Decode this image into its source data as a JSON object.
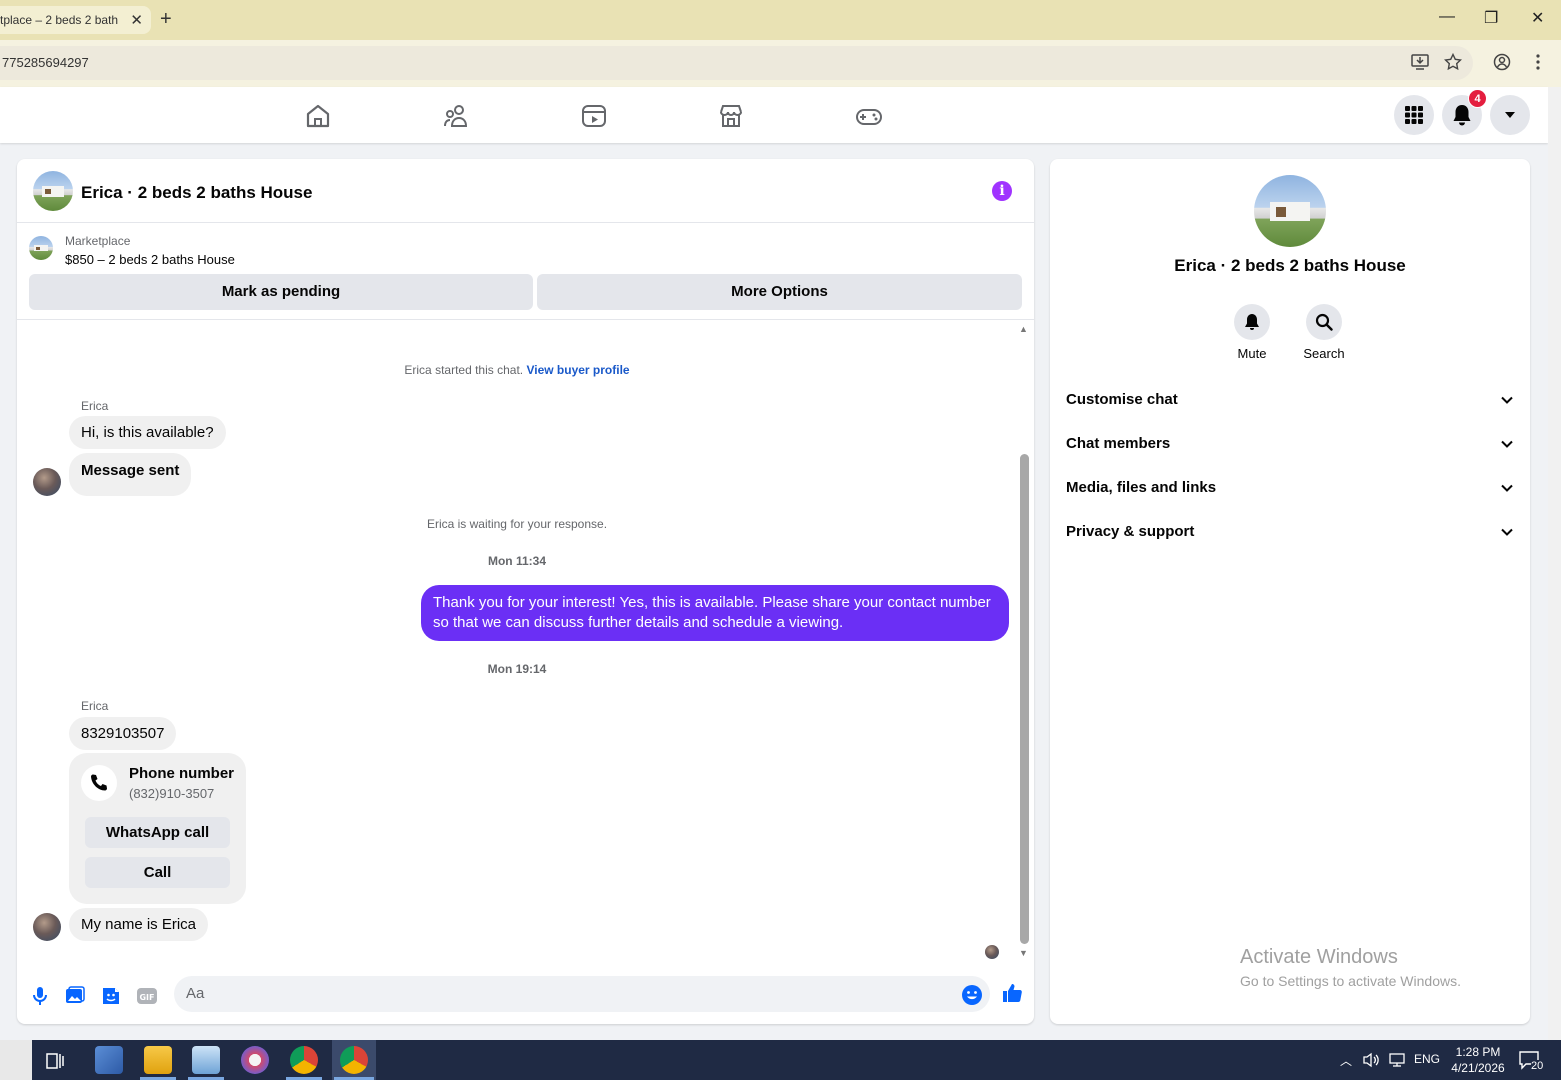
{
  "browser": {
    "tab_title": "tplace – 2 beds 2 bath",
    "tab_close": "✕",
    "new_tab": "+",
    "url": "775285694297",
    "window": {
      "minimize": "—",
      "restore": "❐",
      "close": "✕"
    }
  },
  "fb_nav": {
    "notification_count": "4"
  },
  "chat": {
    "title": "Erica · 2 beds 2 baths House",
    "listing_source": "Marketplace",
    "listing_price_title": "$850 – 2 beds 2 baths House",
    "mark_pending_label": "Mark as pending",
    "more_options_label": "More Options",
    "started_text": "Erica started this chat.",
    "view_profile_link": "View buyer profile",
    "sender_name_1": "Erica",
    "msg_1": "Hi, is this available?",
    "msg_2": "Message sent",
    "waiting_text": "Erica is waiting for your response.",
    "timestamp_1": "Mon 11:34",
    "reply": "Thank you for your interest! Yes, this is available. Please share your contact number so that we can discuss further details and schedule a viewing.",
    "timestamp_2": "Mon 19:14",
    "sender_name_2": "Erica",
    "msg_3": "8329103507",
    "phone_card": {
      "title": "Phone number",
      "number": "(832)910-3507",
      "whatsapp_label": "WhatsApp call",
      "call_label": "Call"
    },
    "msg_4": "My name is Erica",
    "composer_placeholder": "Aa"
  },
  "side_panel": {
    "name": "Erica · 2 beds 2 baths House",
    "mute_label": "Mute",
    "search_label": "Search",
    "sections": [
      "Customise chat",
      "Chat members",
      "Media, files and links",
      "Privacy & support"
    ]
  },
  "watermark": {
    "line1": "Activate Windows",
    "line2": "Go to Settings to activate Windows."
  },
  "taskbar": {
    "lang": "ENG",
    "time": "1:28 PM",
    "date": "4/21/2026",
    "notif_count": "20"
  },
  "colors": {
    "accent_purple": "#6b2ff5",
    "info_purple": "#a033ff",
    "badge_red": "#e41e3f",
    "link_blue": "#1a59c9"
  }
}
